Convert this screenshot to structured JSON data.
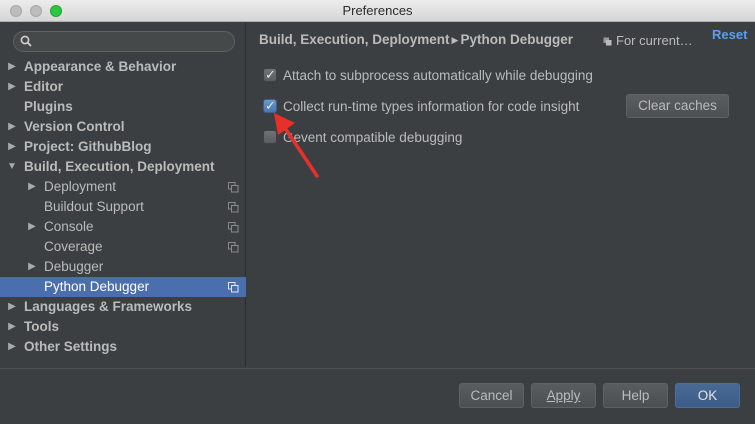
{
  "window": {
    "title": "Preferences"
  },
  "search": {
    "placeholder": ""
  },
  "sidebar": {
    "items": [
      {
        "label": "Appearance & Behavior",
        "level": 0,
        "expand": "collapsed",
        "bold": true
      },
      {
        "label": "Editor",
        "level": 0,
        "expand": "collapsed",
        "bold": true
      },
      {
        "label": "Plugins",
        "level": 0,
        "expand": "none",
        "bold": true
      },
      {
        "label": "Version Control",
        "level": 0,
        "expand": "collapsed",
        "bold": true
      },
      {
        "label": "Project: GithubBlog",
        "level": 0,
        "expand": "collapsed",
        "bold": true
      },
      {
        "label": "Build, Execution, Deployment",
        "level": 0,
        "expand": "expanded",
        "bold": true
      },
      {
        "label": "Deployment",
        "level": 1,
        "expand": "collapsed",
        "copy_icon": true
      },
      {
        "label": "Buildout Support",
        "level": 1,
        "expand": "none",
        "copy_icon": true
      },
      {
        "label": "Console",
        "level": 1,
        "expand": "collapsed",
        "copy_icon": true
      },
      {
        "label": "Coverage",
        "level": 1,
        "expand": "none",
        "copy_icon": true
      },
      {
        "label": "Debugger",
        "level": 1,
        "expand": "collapsed",
        "copy_icon": false
      },
      {
        "label": "Python Debugger",
        "level": 1,
        "expand": "none",
        "copy_icon": true,
        "selected": true
      },
      {
        "label": "Languages & Frameworks",
        "level": 0,
        "expand": "collapsed",
        "bold": true
      },
      {
        "label": "Tools",
        "level": 0,
        "expand": "collapsed",
        "bold": true
      },
      {
        "label": "Other Settings",
        "level": 0,
        "expand": "collapsed",
        "bold": true
      }
    ]
  },
  "main": {
    "breadcrumb": {
      "parent": "Build, Execution, Deployment",
      "current": "Python Debugger"
    },
    "scope_label": "For current…",
    "reset_label": "Reset",
    "options": [
      {
        "label": "Attach to subprocess automatically while debugging",
        "checked": true
      },
      {
        "label": "Collect run-time types information for code insight",
        "checked": true,
        "focused": true
      },
      {
        "label": "Gevent compatible debugging",
        "checked": false
      }
    ],
    "clear_caches_label": "Clear caches"
  },
  "footer": {
    "cancel_label": "Cancel",
    "apply_label": "Apply",
    "help_label": "Help",
    "ok_label": "OK"
  },
  "colors": {
    "background": "#3c3f41",
    "selection": "#4b6eaf",
    "link": "#589df6",
    "annotation_arrow": "#e8302a"
  },
  "icons": {
    "search": "search-icon",
    "copy": "copy-icon",
    "pointer": "red-arrow-annotation"
  }
}
